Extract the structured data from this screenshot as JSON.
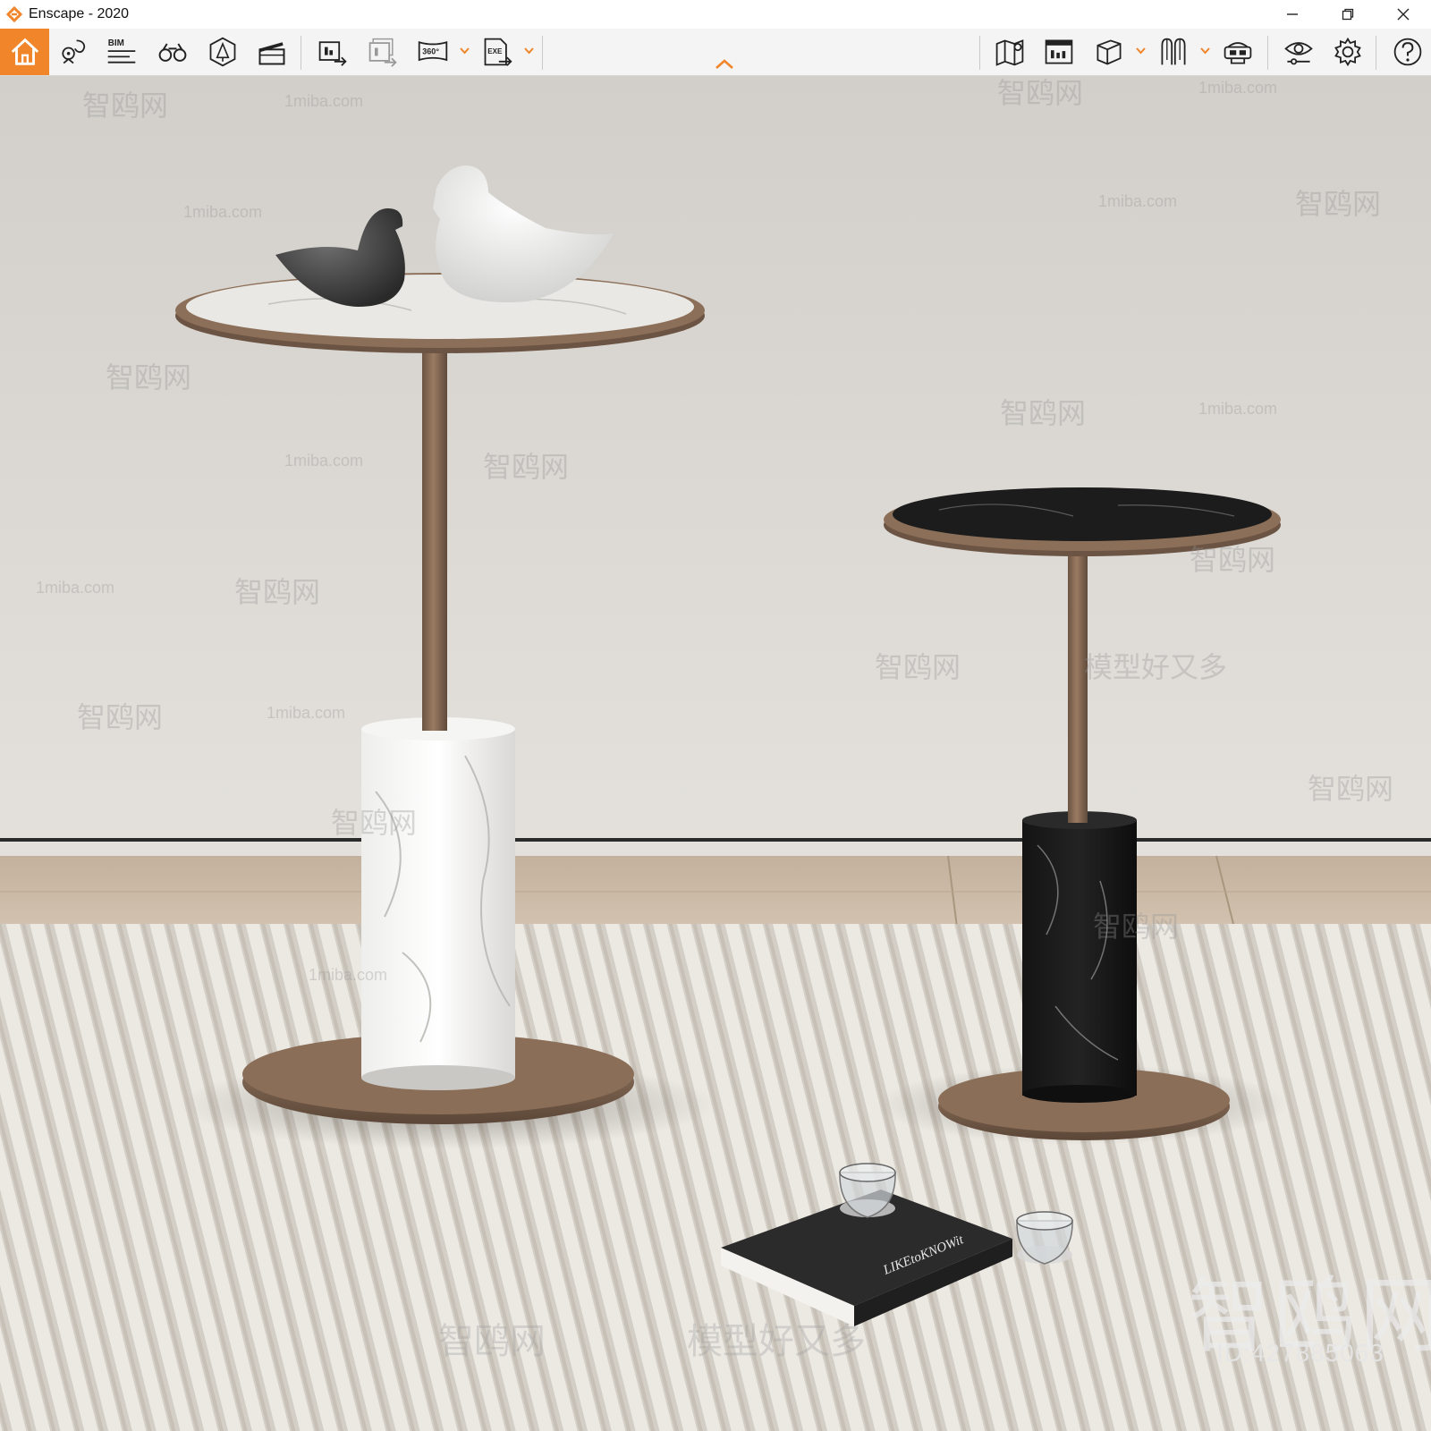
{
  "window": {
    "title": "Enscape - 2020",
    "controls": {
      "minimize_icon": "minimize-icon",
      "restore_icon": "restore-icon",
      "close_icon": "close-icon"
    }
  },
  "toolbar": {
    "accent_color": "#f0852a",
    "bim_label": "BIM",
    "panorama_label": "360°",
    "exe_label": "EXE",
    "left_buttons": [
      "home-icon",
      "view-management-icon",
      "bim-mode-icon",
      "binoculars-icon",
      "asset-library-icon",
      "video-editor-icon",
      "batch-render-icon",
      "render-export-icon",
      "panorama-icon",
      "exe-export-icon"
    ],
    "right_buttons": [
      "map-icon",
      "web-standalone-icon",
      "cube-icon",
      "materials-icon",
      "vr-headset-icon",
      "visual-settings-icon",
      "gear-icon",
      "help-icon"
    ]
  },
  "viewport": {
    "watermark_small": "1miba.com",
    "watermark_cn": "智鸥网",
    "watermark_slogan": "模型好又多",
    "watermark_brand_large": "智鸥网",
    "model_id": "ID:427885063",
    "book_title": "LIKEtoKNOWit"
  }
}
